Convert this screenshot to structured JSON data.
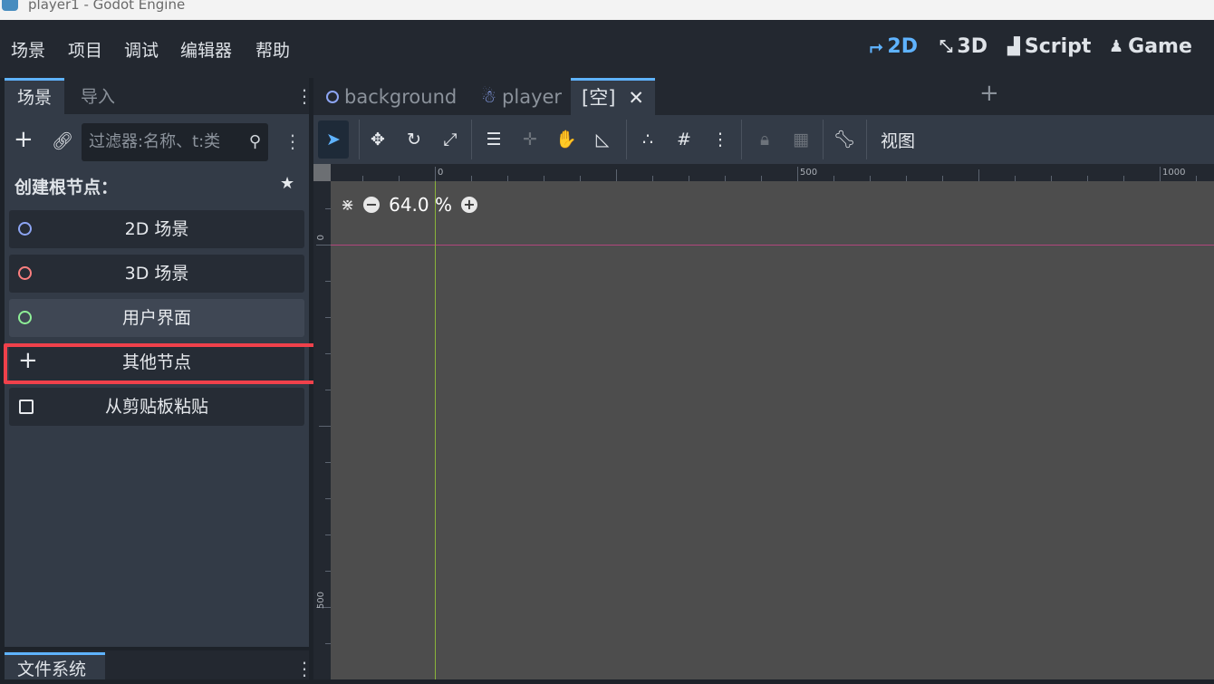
{
  "window": {
    "title": "player1 - Godot Engine"
  },
  "menu": [
    "场景",
    "项目",
    "调试",
    "编辑器",
    "帮助"
  ],
  "workspaces": [
    {
      "label": "2D",
      "icon": "2d-icon",
      "active": true
    },
    {
      "label": "3D",
      "icon": "3d-icon",
      "active": false
    },
    {
      "label": "Script",
      "icon": "script-icon",
      "active": false
    },
    {
      "label": "Game",
      "icon": "game-icon",
      "active": false
    }
  ],
  "dock": {
    "tabs": [
      "场景",
      "导入"
    ],
    "filter_placeholder": "过滤器:名称、t:类",
    "create_root_label": "创建根节点：",
    "root_buttons": [
      {
        "label": "2D 场景",
        "color": "#8da5f3"
      },
      {
        "label": "3D 场景",
        "color": "#fc7f7f"
      },
      {
        "label": "用户界面",
        "color": "#8eef97"
      },
      {
        "label": "其他节点"
      },
      {
        "label": "从剪贴板粘贴"
      }
    ],
    "filesystem_tab": "文件系统"
  },
  "scene_tabs": [
    {
      "label": "background",
      "icon": "node2d-icon"
    },
    {
      "label": "player",
      "icon": "character-icon"
    },
    {
      "label": "[空]",
      "active": true
    }
  ],
  "toolbar": {
    "view_label": "视图"
  },
  "viewport": {
    "zoom": "64.0 %",
    "ruler_top_labels": [
      "0",
      "500",
      "1000"
    ],
    "ruler_left_labels": [
      "0",
      "500"
    ]
  },
  "colors": {
    "accent": "#5fb3ff",
    "highlight": "#f0414b"
  }
}
